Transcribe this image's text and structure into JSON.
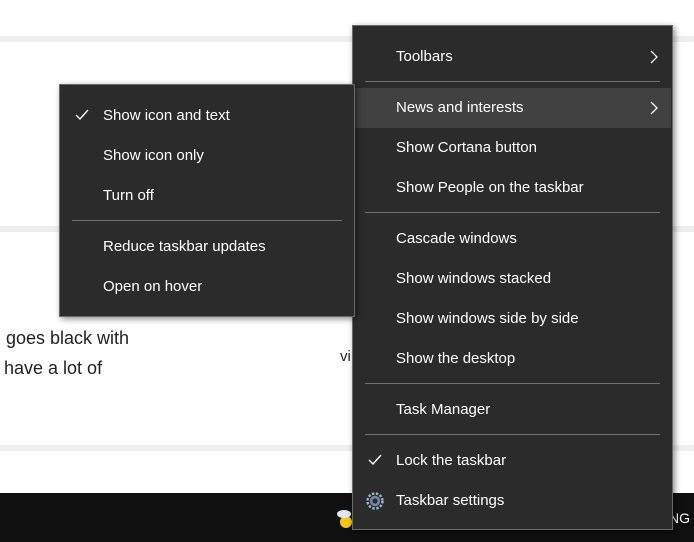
{
  "background": {
    "line1": "goes black with",
    "line2": "have a lot of",
    "fragment": "vi"
  },
  "taskbar": {
    "language": "NG"
  },
  "main_menu": {
    "items": [
      {
        "label": "Toolbars",
        "submenu": true
      },
      {
        "label": "News and interests",
        "submenu": true,
        "highlighted": true
      },
      {
        "label": "Show Cortana button"
      },
      {
        "label": "Show People on the taskbar"
      },
      {
        "label": "Cascade windows"
      },
      {
        "label": "Show windows stacked"
      },
      {
        "label": "Show windows side by side"
      },
      {
        "label": "Show the desktop"
      },
      {
        "label": "Task Manager"
      },
      {
        "label": "Lock the taskbar",
        "checked": true
      },
      {
        "label": "Taskbar settings",
        "icon": "gear-icon"
      }
    ]
  },
  "sub_menu": {
    "items": [
      {
        "label": "Show icon and text",
        "checked": true
      },
      {
        "label": "Show icon only"
      },
      {
        "label": "Turn off"
      },
      {
        "label": "Reduce taskbar updates"
      },
      {
        "label": "Open on hover"
      }
    ]
  }
}
